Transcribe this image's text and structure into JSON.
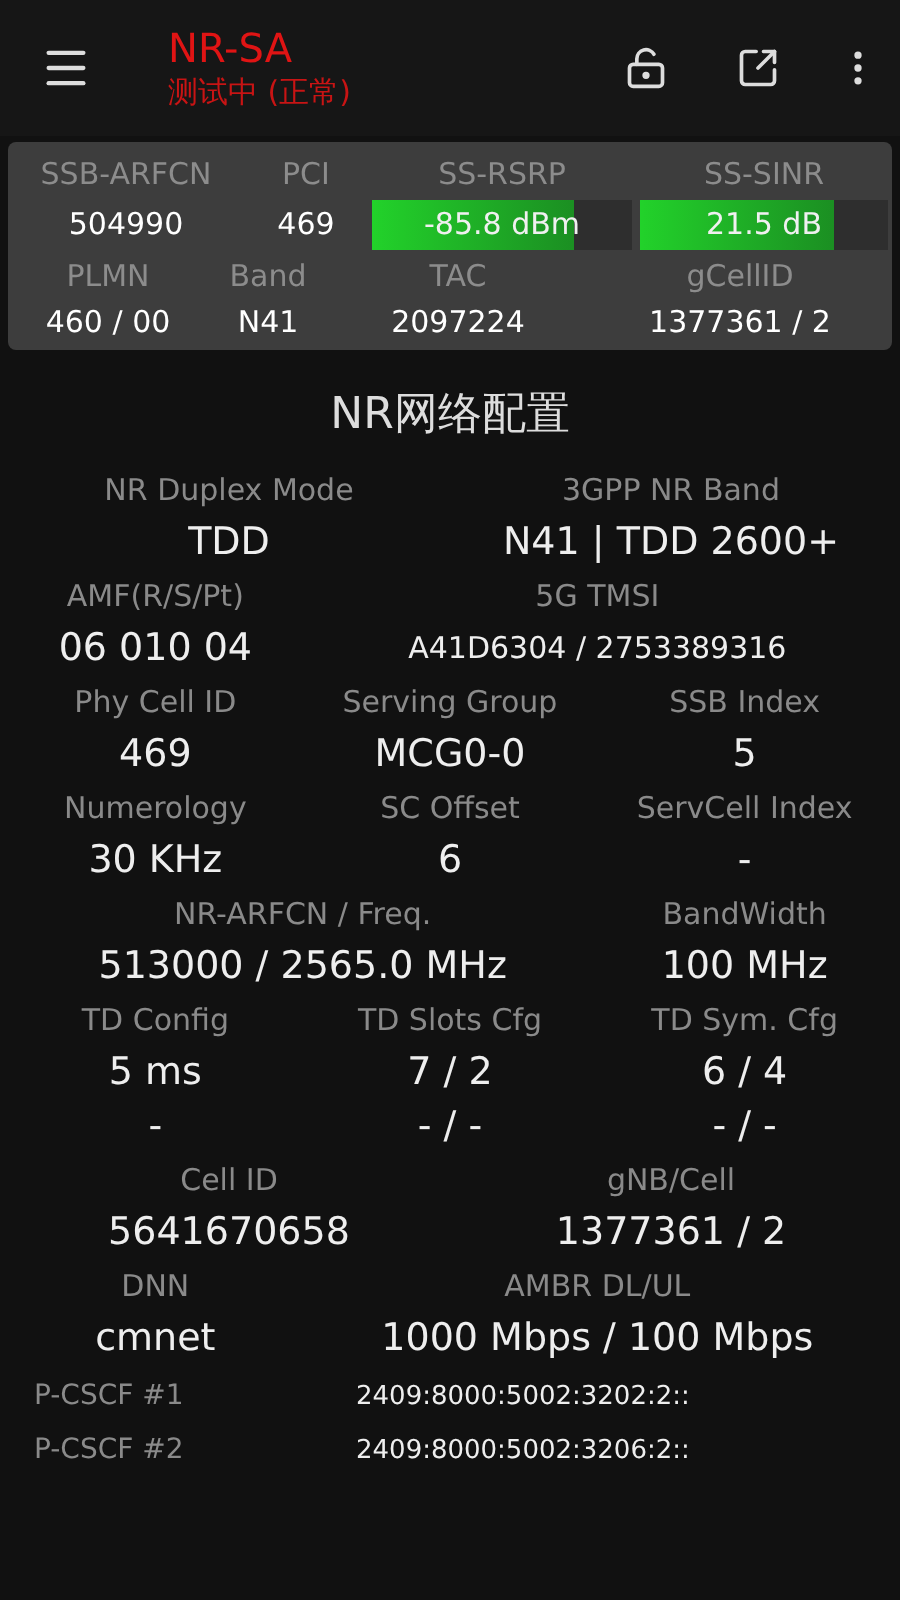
{
  "header": {
    "title": "NR-SA",
    "subtitle": "测试中 (正常)"
  },
  "summary": {
    "row1": [
      {
        "label": "SSB-ARFCN",
        "kind": "text",
        "value": "504990"
      },
      {
        "label": "PCI",
        "kind": "text",
        "value": "469"
      },
      {
        "label": "SS-RSRP",
        "kind": "bar",
        "value": "-85.8 dBm",
        "level": 0.78
      },
      {
        "label": "SS-SINR",
        "kind": "bar",
        "value": "21.5 dB",
        "level": 0.78
      }
    ],
    "row2": [
      {
        "label": "PLMN",
        "value": "460 / 00"
      },
      {
        "label": "Band",
        "value": "N41"
      },
      {
        "label": "TAC",
        "value": "2097224"
      },
      {
        "label": "gCellID",
        "value": "1377361 / 2"
      }
    ]
  },
  "config": {
    "title": "NR网络配置",
    "rows": [
      {
        "kind": "halves",
        "cells": [
          {
            "label": "NR Duplex Mode",
            "values": [
              "TDD"
            ]
          },
          {
            "label": "3GPP NR Band",
            "values": [
              "N41 | TDD 2600+"
            ]
          }
        ]
      },
      {
        "kind": "third_twothirds",
        "cells": [
          {
            "label": "AMF(R/S/Pt)",
            "values": [
              "06 010 04"
            ]
          },
          {
            "label": "5G TMSI",
            "values": [
              "A41D6304 / 2753389316"
            ],
            "small": true
          }
        ]
      },
      {
        "kind": "thirds",
        "cells": [
          {
            "label": "Phy Cell ID",
            "values": [
              "469"
            ]
          },
          {
            "label": "Serving Group",
            "values": [
              "MCG0-0"
            ]
          },
          {
            "label": "SSB Index",
            "values": [
              "5"
            ]
          }
        ]
      },
      {
        "kind": "thirds",
        "cells": [
          {
            "label": "Numerology",
            "values": [
              "30 KHz"
            ]
          },
          {
            "label": "SC Offset",
            "values": [
              "6"
            ]
          },
          {
            "label": "ServCell Index",
            "values": [
              "-"
            ]
          }
        ]
      },
      {
        "kind": "twothirds_third",
        "cells": [
          {
            "label": "NR-ARFCN / Freq.",
            "values": [
              "513000 / 2565.0 MHz"
            ]
          },
          {
            "label": "BandWidth",
            "values": [
              "100 MHz"
            ]
          }
        ]
      },
      {
        "kind": "thirds",
        "cells": [
          {
            "label": "TD Config",
            "values": [
              "5 ms",
              "-"
            ]
          },
          {
            "label": "TD Slots Cfg",
            "values": [
              "7 / 2",
              "- / -"
            ]
          },
          {
            "label": "TD Sym. Cfg",
            "values": [
              "6 / 4",
              "- / -"
            ]
          }
        ]
      },
      {
        "kind": "halves",
        "cells": [
          {
            "label": "Cell ID",
            "values": [
              "5641670658"
            ]
          },
          {
            "label": "gNB/Cell",
            "values": [
              "1377361 / 2"
            ]
          }
        ]
      },
      {
        "kind": "third_twothirds",
        "cells": [
          {
            "label": "DNN",
            "values": [
              "cmnet"
            ]
          },
          {
            "label": "AMBR DL/UL",
            "values": [
              "1000 Mbps / 100 Mbps"
            ]
          }
        ]
      }
    ],
    "pcscf": [
      {
        "label": "P-CSCF #1",
        "value": "2409:8000:5002:3202:2::"
      },
      {
        "label": "P-CSCF #2",
        "value": "2409:8000:5002:3206:2::"
      }
    ]
  }
}
